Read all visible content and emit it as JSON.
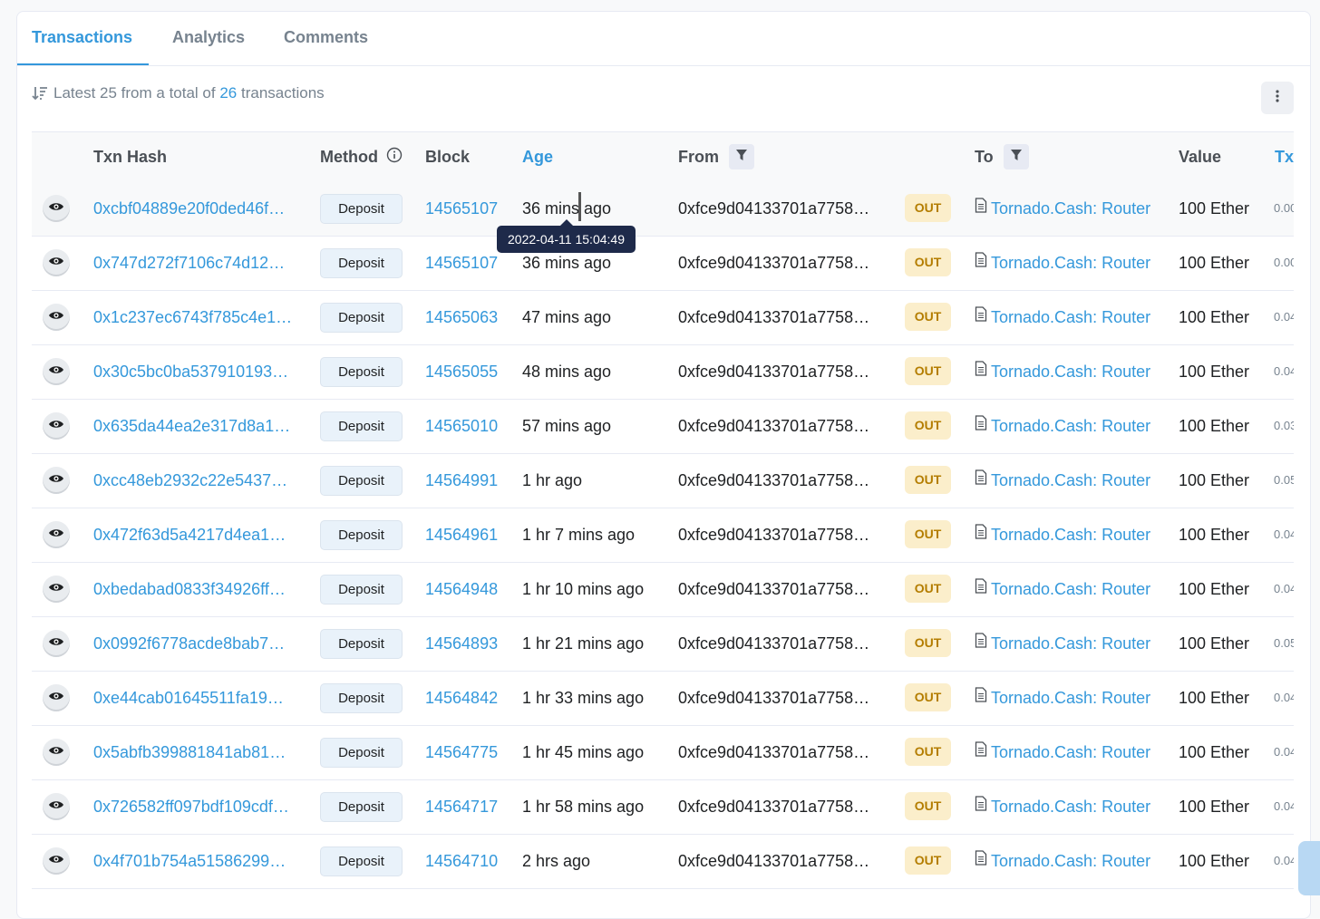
{
  "tabs": [
    {
      "label": "Transactions",
      "active": true
    },
    {
      "label": "Analytics",
      "active": false
    },
    {
      "label": "Comments",
      "active": false
    }
  ],
  "summary": {
    "prefix": "Latest 25 from a total of",
    "count": "26",
    "suffix": "transactions"
  },
  "columns": {
    "txn_hash": "Txn Hash",
    "method": "Method",
    "block": "Block",
    "age": "Age",
    "from": "From",
    "to": "To",
    "value": "Value",
    "txn_fee": "Tx"
  },
  "tooltip": "2022-04-11 15:04:49",
  "rows": [
    {
      "hash": "0xcbf04889e20f0ded46f…",
      "method": "Deposit",
      "block": "14565107",
      "age": "36 mins ago",
      "from": "0xfce9d04133701a7758…",
      "direction": "OUT",
      "to": "Tornado.Cash: Router",
      "value": "100 Ether",
      "fee": "0.00"
    },
    {
      "hash": "0x747d272f7106c74d12…",
      "method": "Deposit",
      "block": "14565107",
      "age": "36 mins ago",
      "from": "0xfce9d04133701a7758…",
      "direction": "OUT",
      "to": "Tornado.Cash: Router",
      "value": "100 Ether",
      "fee": "0.00"
    },
    {
      "hash": "0x1c237ec6743f785c4e1…",
      "method": "Deposit",
      "block": "14565063",
      "age": "47 mins ago",
      "from": "0xfce9d04133701a7758…",
      "direction": "OUT",
      "to": "Tornado.Cash: Router",
      "value": "100 Ether",
      "fee": "0.04"
    },
    {
      "hash": "0x30c5bc0ba537910193…",
      "method": "Deposit",
      "block": "14565055",
      "age": "48 mins ago",
      "from": "0xfce9d04133701a7758…",
      "direction": "OUT",
      "to": "Tornado.Cash: Router",
      "value": "100 Ether",
      "fee": "0.04"
    },
    {
      "hash": "0x635da44ea2e317d8a1…",
      "method": "Deposit",
      "block": "14565010",
      "age": "57 mins ago",
      "from": "0xfce9d04133701a7758…",
      "direction": "OUT",
      "to": "Tornado.Cash: Router",
      "value": "100 Ether",
      "fee": "0.03"
    },
    {
      "hash": "0xcc48eb2932c22e5437…",
      "method": "Deposit",
      "block": "14564991",
      "age": "1 hr ago",
      "from": "0xfce9d04133701a7758…",
      "direction": "OUT",
      "to": "Tornado.Cash: Router",
      "value": "100 Ether",
      "fee": "0.05"
    },
    {
      "hash": "0x472f63d5a4217d4ea1…",
      "method": "Deposit",
      "block": "14564961",
      "age": "1 hr 7 mins ago",
      "from": "0xfce9d04133701a7758…",
      "direction": "OUT",
      "to": "Tornado.Cash: Router",
      "value": "100 Ether",
      "fee": "0.04"
    },
    {
      "hash": "0xbedabad0833f34926ff…",
      "method": "Deposit",
      "block": "14564948",
      "age": "1 hr 10 mins ago",
      "from": "0xfce9d04133701a7758…",
      "direction": "OUT",
      "to": "Tornado.Cash: Router",
      "value": "100 Ether",
      "fee": "0.04"
    },
    {
      "hash": "0x0992f6778acde8bab7…",
      "method": "Deposit",
      "block": "14564893",
      "age": "1 hr 21 mins ago",
      "from": "0xfce9d04133701a7758…",
      "direction": "OUT",
      "to": "Tornado.Cash: Router",
      "value": "100 Ether",
      "fee": "0.05"
    },
    {
      "hash": "0xe44cab01645511fa19…",
      "method": "Deposit",
      "block": "14564842",
      "age": "1 hr 33 mins ago",
      "from": "0xfce9d04133701a7758…",
      "direction": "OUT",
      "to": "Tornado.Cash: Router",
      "value": "100 Ether",
      "fee": "0.04"
    },
    {
      "hash": "0x5abfb399881841ab81…",
      "method": "Deposit",
      "block": "14564775",
      "age": "1 hr 45 mins ago",
      "from": "0xfce9d04133701a7758…",
      "direction": "OUT",
      "to": "Tornado.Cash: Router",
      "value": "100 Ether",
      "fee": "0.04"
    },
    {
      "hash": "0x726582ff097bdf109cdf…",
      "method": "Deposit",
      "block": "14564717",
      "age": "1 hr 58 mins ago",
      "from": "0xfce9d04133701a7758…",
      "direction": "OUT",
      "to": "Tornado.Cash: Router",
      "value": "100 Ether",
      "fee": "0.04"
    },
    {
      "hash": "0x4f701b754a51586299…",
      "method": "Deposit",
      "block": "14564710",
      "age": "2 hrs ago",
      "from": "0xfce9d04133701a7758…",
      "direction": "OUT",
      "to": "Tornado.Cash: Router",
      "value": "100 Ether",
      "fee": "0.04"
    }
  ],
  "colors": {
    "accent": "#3498db",
    "muted": "#77838f",
    "out_badge_bg": "#fbeecb",
    "out_badge_text": "#b47d00",
    "tooltip_bg": "#1e2a4a"
  },
  "icons": [
    "sort-icon",
    "more-vertical-icon",
    "info-icon",
    "filter-icon",
    "eye-icon",
    "document-icon"
  ]
}
